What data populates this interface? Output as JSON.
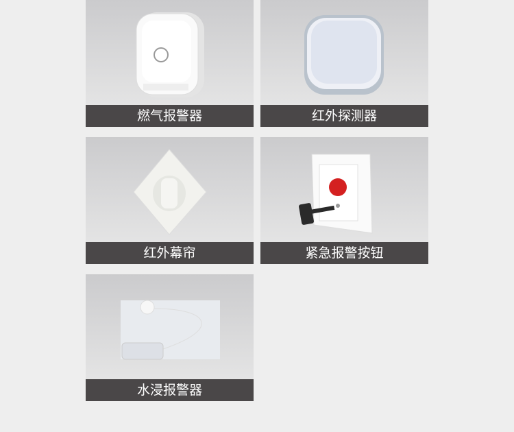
{
  "products": [
    {
      "label": "燃气报警器"
    },
    {
      "label": "红外探测器"
    },
    {
      "label": "红外幕帘"
    },
    {
      "label": "紧急报警按钮"
    },
    {
      "label": "水浸报警器"
    }
  ],
  "colors": {
    "caption_bg": "#4a4748",
    "page_bg": "#eeeeee",
    "button_red": "#d42020"
  }
}
